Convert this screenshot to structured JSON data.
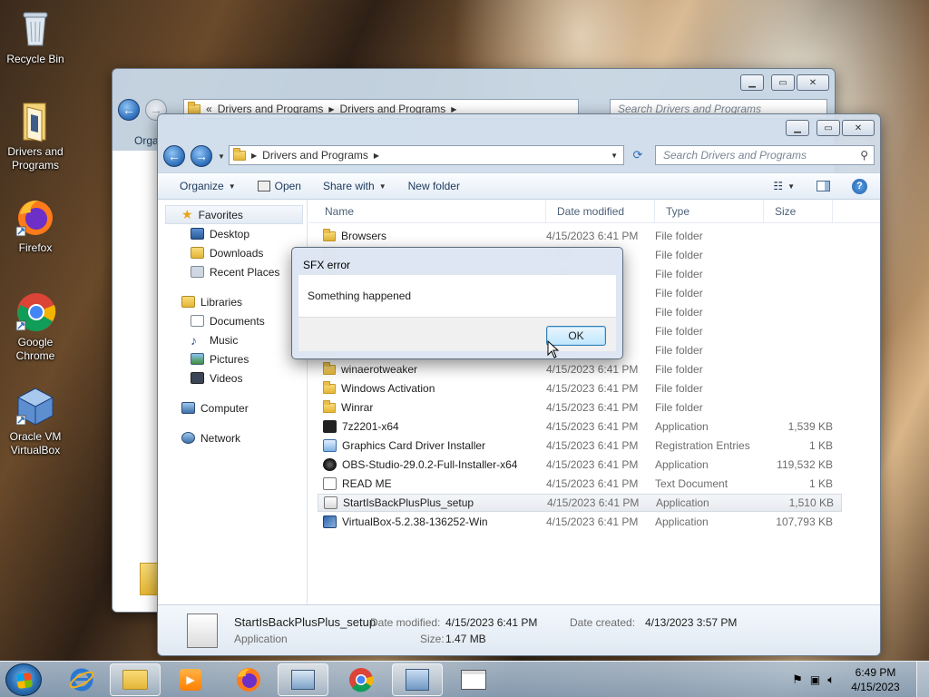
{
  "desktop": {
    "icons": [
      {
        "label": "Recycle Bin"
      },
      {
        "label": "Drivers and Programs"
      },
      {
        "label": "Firefox"
      },
      {
        "label": "Google Chrome"
      },
      {
        "label": "Oracle VM VirtualBox"
      }
    ]
  },
  "back_window": {
    "path": [
      "«",
      "Drivers and Programs",
      "Drivers and Programs"
    ],
    "search_placeholder": "Search Drivers and Programs",
    "organize_label": "Orga"
  },
  "window": {
    "path": [
      "Drivers and Programs"
    ],
    "search_placeholder": "Search Drivers and Programs",
    "toolbar": {
      "organize": "Organize",
      "open": "Open",
      "share_with": "Share with",
      "new_folder": "New folder"
    },
    "nav": {
      "favorites": "Favorites",
      "desktop": "Desktop",
      "downloads": "Downloads",
      "recent_places": "Recent Places",
      "libraries": "Libraries",
      "documents": "Documents",
      "music": "Music",
      "pictures": "Pictures",
      "videos": "Videos",
      "computer": "Computer",
      "network": "Network"
    },
    "columns": {
      "name": "Name",
      "date": "Date modified",
      "type": "Type",
      "size": "Size"
    },
    "files": [
      {
        "name": "Browsers",
        "date": "4/15/2023 6:41 PM",
        "type": "File folder",
        "size": "",
        "kind": "folder"
      },
      {
        "name": "",
        "date": "1 PM",
        "type": "File folder",
        "size": "",
        "kind": "folder"
      },
      {
        "name": "",
        "date": "1 PM",
        "type": "File folder",
        "size": "",
        "kind": "folder"
      },
      {
        "name": "",
        "date": "1 PM",
        "type": "File folder",
        "size": "",
        "kind": "folder"
      },
      {
        "name": "",
        "date": "1 PM",
        "type": "File folder",
        "size": "",
        "kind": "folder"
      },
      {
        "name": "",
        "date": "1 PM",
        "type": "File folder",
        "size": "",
        "kind": "folder"
      },
      {
        "name": "",
        "date": "1 PM",
        "type": "File folder",
        "size": "",
        "kind": "folder"
      },
      {
        "name": "winaerotweaker",
        "date": "4/15/2023 6:41 PM",
        "type": "File folder",
        "size": "",
        "kind": "folder"
      },
      {
        "name": "Windows Activation",
        "date": "4/15/2023 6:41 PM",
        "type": "File folder",
        "size": "",
        "kind": "folder"
      },
      {
        "name": "Winrar",
        "date": "4/15/2023 6:41 PM",
        "type": "File folder",
        "size": "",
        "kind": "folder"
      },
      {
        "name": "7z2201-x64",
        "date": "4/15/2023 6:41 PM",
        "type": "Application",
        "size": "1,539 KB",
        "kind": "z"
      },
      {
        "name": "Graphics Card Driver Installer",
        "date": "4/15/2023 6:41 PM",
        "type": "Registration Entries",
        "size": "1 KB",
        "kind": "reg"
      },
      {
        "name": "OBS-Studio-29.0.2-Full-Installer-x64",
        "date": "4/15/2023 6:41 PM",
        "type": "Application",
        "size": "119,532 KB",
        "kind": "obs"
      },
      {
        "name": "READ ME",
        "date": "4/15/2023 6:41 PM",
        "type": "Text Document",
        "size": "1 KB",
        "kind": "txt"
      },
      {
        "name": "StartIsBackPlusPlus_setup",
        "date": "4/15/2023 6:41 PM",
        "type": "Application",
        "size": "1,510 KB",
        "kind": "app"
      },
      {
        "name": "VirtualBox-5.2.38-136252-Win",
        "date": "4/15/2023 6:41 PM",
        "type": "Application",
        "size": "107,793 KB",
        "kind": "vbox"
      }
    ],
    "details": {
      "name": "StartIsBackPlusPlus_setup",
      "type": "Application",
      "modified_label": "Date modified:",
      "modified": "4/15/2023 6:41 PM",
      "size_label": "Size:",
      "size": "1.47 MB",
      "created_label": "Date created:",
      "created": "4/13/2023 3:57 PM"
    }
  },
  "dialog": {
    "title": "SFX error",
    "message": "Something happened",
    "ok": "OK"
  },
  "taskbar": {
    "time": "6:49 PM",
    "date": "4/15/2023"
  }
}
